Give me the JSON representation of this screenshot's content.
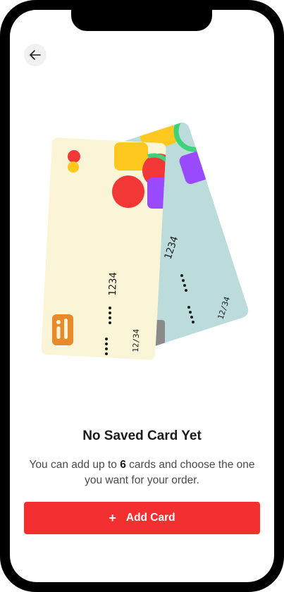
{
  "header": {
    "back_icon": "arrow-left-icon"
  },
  "illustration": {
    "back_card": {
      "number": "1234",
      "expiry": "12/34"
    },
    "front_card": {
      "number": "1234",
      "expiry": "12/34"
    },
    "colors": {
      "front_card": "#fbf5d7",
      "back_card": "#bcdcdc",
      "red": "#f23737",
      "yellow": "#ffc81e",
      "purple": "#9b4bff",
      "green": "#3ed27a",
      "orange": "#e88a2c"
    }
  },
  "empty_state": {
    "title": "No Saved Card Yet",
    "subtitle_before": "You can add up to ",
    "subtitle_count": "6",
    "subtitle_after": " cards and choose the one you want for your order."
  },
  "primary_action": {
    "plus_icon": "plus-icon",
    "label": "Add Card"
  },
  "theme": {
    "accent": "#f23030"
  }
}
